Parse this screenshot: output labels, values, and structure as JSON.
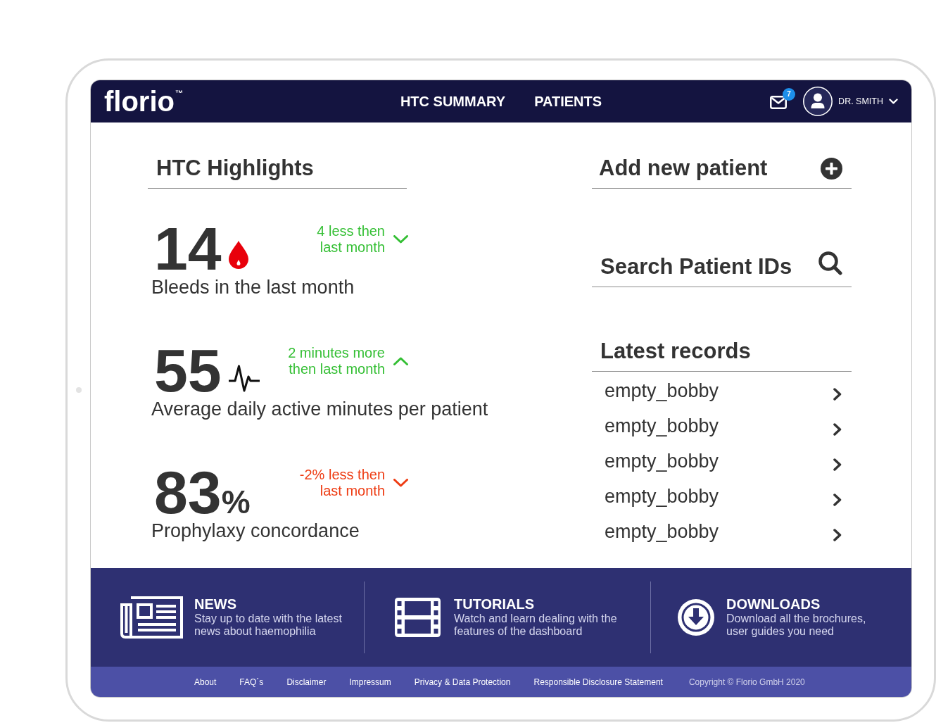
{
  "header": {
    "logo": {
      "text": "florio",
      "trademark": "™"
    },
    "nav": [
      {
        "label": "HTC SUMMARY"
      },
      {
        "label": "PATIENTS"
      }
    ],
    "messages": {
      "badge": "7"
    },
    "user": {
      "name": "DR. SMITH"
    }
  },
  "highlights": {
    "title": "HTC Highlights",
    "stats": [
      {
        "kind": "bleeds",
        "value": "14",
        "trend": {
          "lines": [
            "4 less then",
            "last month"
          ],
          "rising": false,
          "color": "#34bf34"
        },
        "label": "Bleeds in the last month"
      },
      {
        "kind": "activity",
        "value": "55",
        "trend": {
          "lines": [
            "2 minutes more",
            "then last month"
          ],
          "rising": true,
          "color": "#34bf34"
        },
        "label": "Average daily active minutes per patient"
      },
      {
        "kind": "concordance",
        "value": "83",
        "unit": "%",
        "trend": {
          "lines": [
            "-2% less then",
            "last month"
          ],
          "rising": false,
          "color": "#ee3b12"
        },
        "label": "Prophylaxy concordance"
      }
    ]
  },
  "side_panel": {
    "add_patient": {
      "label": "Add new patient"
    },
    "search": {
      "label": "Search Patient IDs"
    },
    "latest_records": {
      "title": "Latest records",
      "items": [
        {
          "name": "empty_bobby"
        },
        {
          "name": "empty_bobby"
        },
        {
          "name": "empty_bobby"
        },
        {
          "name": "empty_bobby"
        },
        {
          "name": "empty_bobby"
        }
      ]
    }
  },
  "footer": {
    "sections": [
      {
        "kind": "news",
        "title": "NEWS",
        "lines": [
          "Stay up to date with the latest",
          "news about haemophilia"
        ]
      },
      {
        "kind": "tutorials",
        "title": "TUTORIALS",
        "lines": [
          "Watch and learn dealing with the",
          "features of the dashboard"
        ]
      },
      {
        "kind": "downloads",
        "title": "DOWNLOADS",
        "lines": [
          "Download all the brochures,",
          "user guides you need"
        ]
      }
    ],
    "links": [
      "About",
      "FAQ´s",
      "Disclaimer",
      "Impressum",
      "Privacy & Data Protection",
      "Responsible Disclosure Statement"
    ],
    "copyright": "Copyright © Florio GmbH 2020"
  }
}
